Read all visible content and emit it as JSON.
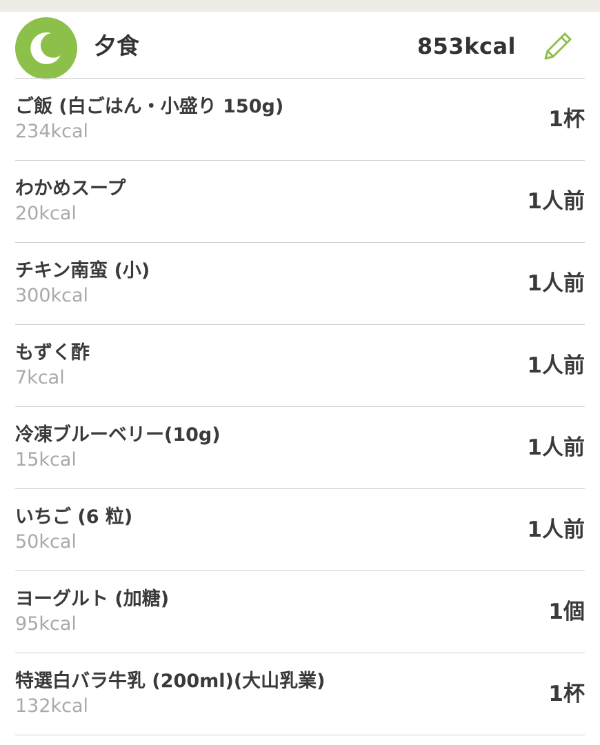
{
  "meal": {
    "icon": "moon-icon",
    "title": "夕食",
    "total_kcal": "853kcal",
    "edit_icon": "pencil-icon",
    "accent_color": "#8dc04a"
  },
  "items": [
    {
      "name": "ご飯 (白ごはん・小盛り 150g)",
      "kcal": "234kcal",
      "amount": "1杯"
    },
    {
      "name": "わかめスープ",
      "kcal": "20kcal",
      "amount": "1人前"
    },
    {
      "name": "チキン南蛮 (小)",
      "kcal": "300kcal",
      "amount": "1人前"
    },
    {
      "name": "もずく酢",
      "kcal": "7kcal",
      "amount": "1人前"
    },
    {
      "name": "冷凍ブルーベリー(10g)",
      "kcal": "15kcal",
      "amount": "1人前"
    },
    {
      "name": "いちご (6 粒)",
      "kcal": "50kcal",
      "amount": "1人前"
    },
    {
      "name": "ヨーグルト (加糖)",
      "kcal": "95kcal",
      "amount": "1個"
    },
    {
      "name": "特選白バラ牛乳 (200ml)(大山乳業)",
      "kcal": "132kcal",
      "amount": "1杯"
    }
  ]
}
